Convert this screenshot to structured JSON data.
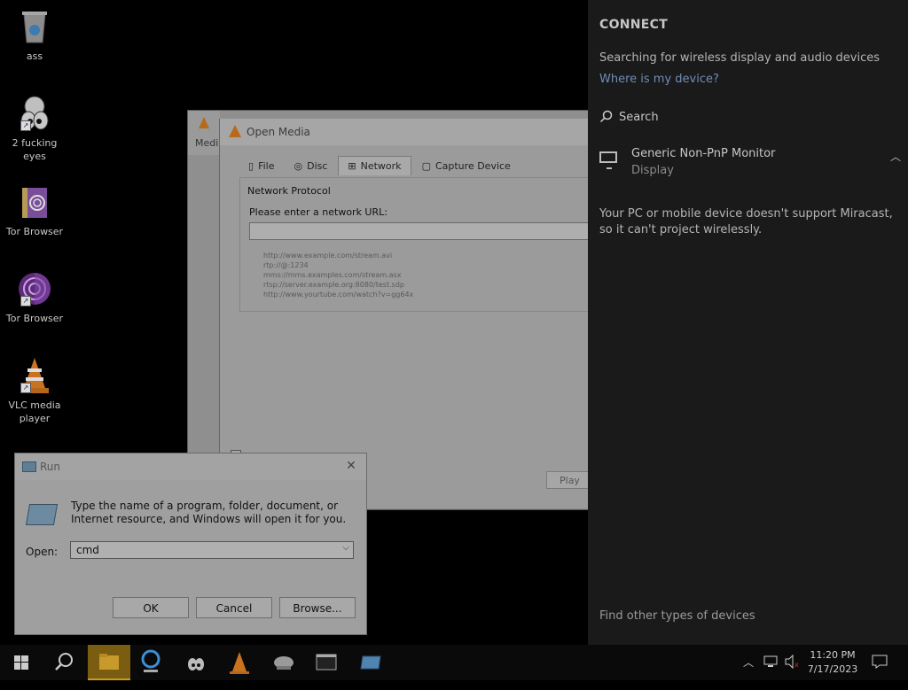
{
  "desktop": {
    "icons": [
      {
        "label": "ass"
      },
      {
        "label": "2 fucking eyes"
      },
      {
        "label": "Tor Browser"
      },
      {
        "label": "Tor Browser"
      },
      {
        "label": "VLC media player"
      }
    ]
  },
  "vlc_back": {
    "title_fragment": "Medi"
  },
  "open_media": {
    "title": "Open Media",
    "tabs": [
      {
        "label": "File"
      },
      {
        "label": "Disc"
      },
      {
        "label": "Network"
      },
      {
        "label": "Capture Device"
      }
    ],
    "group_label": "Network Protocol",
    "url_label": "Please enter a network URL:",
    "url_value": "",
    "examples": [
      "http://www.example.com/stream.avi",
      "rtp://@:1234",
      "mms://mms.examples.com/stream.asx",
      "rtsp://server.example.org:8080/test.sdp",
      "http://www.yourtube.com/watch?v=gg64x"
    ],
    "play_label": "Play"
  },
  "run": {
    "title": "Run",
    "description": "Type the name of a program, folder, document, or Internet resource, and Windows will open it for you.",
    "open_label": "Open:",
    "input_value": "cmd",
    "buttons": {
      "ok": "OK",
      "cancel": "Cancel",
      "browse": "Browse..."
    }
  },
  "connect": {
    "header": "CONNECT",
    "status": "Searching for wireless display and audio devices",
    "where_link": "Where is my device?",
    "search": "Search",
    "device": {
      "name": "Generic Non-PnP Monitor",
      "type": "Display"
    },
    "note": "Your PC or mobile device doesn't support Miracast, so it can't project wirelessly.",
    "other": "Find other types of devices"
  },
  "taskbar": {
    "time": "11:20 PM",
    "date": "7/17/2023"
  }
}
